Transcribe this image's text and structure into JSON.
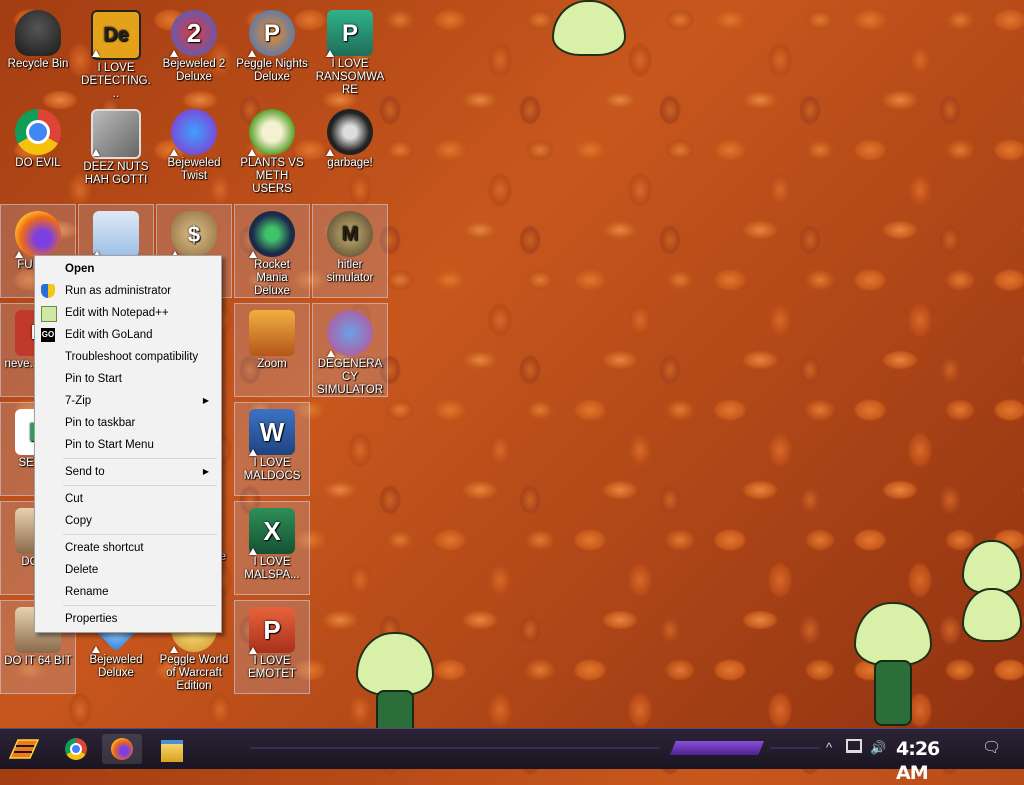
{
  "desktop": {
    "icons": [
      {
        "label": "Recycle Bin",
        "glyph": "",
        "color": "#3a3a3a"
      },
      {
        "label": "I LOVE DETECTING...",
        "glyph": "De",
        "color": "#e3a21a"
      },
      {
        "label": "Bejeweled 2 Deluxe",
        "glyph": "2",
        "color": "#3b64d8"
      },
      {
        "label": "Peggle Nights Deluxe",
        "glyph": "P",
        "color": "#2a76d2"
      },
      {
        "label": "I LOVE RANSOMWARE",
        "glyph": "P",
        "color": "#1f8b70"
      },
      {
        "label": "DO EVIL",
        "glyph": "",
        "color": "#ffffff"
      },
      {
        "label": "DEEZ NUTS HAH GOTTI",
        "glyph": "",
        "color": "#8a8a8a"
      },
      {
        "label": "Bejeweled Twist",
        "glyph": "",
        "color": "#8f2bc9"
      },
      {
        "label": "PLANTS VS METH USERS",
        "glyph": "",
        "color": "#5aa02c"
      },
      {
        "label": "garbage!",
        "glyph": "",
        "color": "#222222"
      },
      {
        "label": "FURR...",
        "glyph": "",
        "color": "#f06b14"
      },
      {
        "label": "",
        "glyph": "",
        "color": "#9bbfe6"
      },
      {
        "label": "",
        "glyph": "$",
        "color": "#b08a4a"
      },
      {
        "label": "Rocket Mania Deluxe",
        "glyph": "",
        "color": "#1c2a4a"
      },
      {
        "label": "hitler simulator",
        "glyph": "M",
        "color": "#4b3b22"
      },
      {
        "label": "neve... why...",
        "glyph": "D",
        "color": "#c0392b"
      },
      {
        "label": "Zoom",
        "glyph": "",
        "color": "#d98a1e"
      },
      {
        "label": "DEGENERACY SIMULATOR",
        "glyph": "",
        "color": "#c54b8c"
      },
      {
        "label": "SEX I...",
        "glyph": "H",
        "color": "#2e9e5a"
      },
      {
        "label": "I LOVE MALDOCS",
        "glyph": "W",
        "color": "#2b579a"
      },
      {
        "label": "DO I...",
        "glyph": "",
        "color": "#d8b48a"
      },
      {
        "label": "I LOVE MALSPA...",
        "glyph": "X",
        "color": "#217346"
      },
      {
        "label": "DO IT 64 BIT",
        "glyph": "",
        "color": "#d8b48a"
      },
      {
        "label": "Bejeweled Deluxe",
        "glyph": "",
        "color": "#2f7fd8"
      },
      {
        "label": "Peggle World of Warcraft Edition",
        "glyph": "",
        "color": "#c9912c"
      },
      {
        "label": "I LOVE EMOTET",
        "glyph": "P",
        "color": "#d24726"
      }
    ],
    "partial_label": "ke"
  },
  "context_menu": {
    "items": [
      {
        "label": "Open",
        "icon": ""
      },
      {
        "label": "Run as administrator",
        "icon": "shield-icon"
      },
      {
        "label": "Edit with Notepad++",
        "icon": "notepad-icon"
      },
      {
        "label": "Edit with GoLand",
        "icon": "goland-icon"
      },
      {
        "label": "Troubleshoot compatibility",
        "icon": ""
      },
      {
        "label": "Pin to Start",
        "icon": ""
      },
      {
        "label": "7-Zip",
        "icon": ""
      },
      {
        "label": "Pin to taskbar",
        "icon": ""
      },
      {
        "label": "Pin to Start Menu",
        "icon": ""
      },
      {
        "label": "Send to",
        "icon": ""
      },
      {
        "label": "Cut",
        "icon": ""
      },
      {
        "label": "Copy",
        "icon": ""
      },
      {
        "label": "Create shortcut",
        "icon": ""
      },
      {
        "label": "Delete",
        "icon": ""
      },
      {
        "label": "Rename",
        "icon": ""
      },
      {
        "label": "Properties",
        "icon": ""
      }
    ],
    "submenu_marker": "▶",
    "goland_text": "GO"
  },
  "taskbar": {
    "clock": "4:26 AM",
    "pinned": [
      "chrome-icon",
      "firefox-icon",
      "file-explorer-icon"
    ],
    "tray": {
      "chevron": "^",
      "volume": "🔊",
      "notifications": "🗨"
    }
  }
}
